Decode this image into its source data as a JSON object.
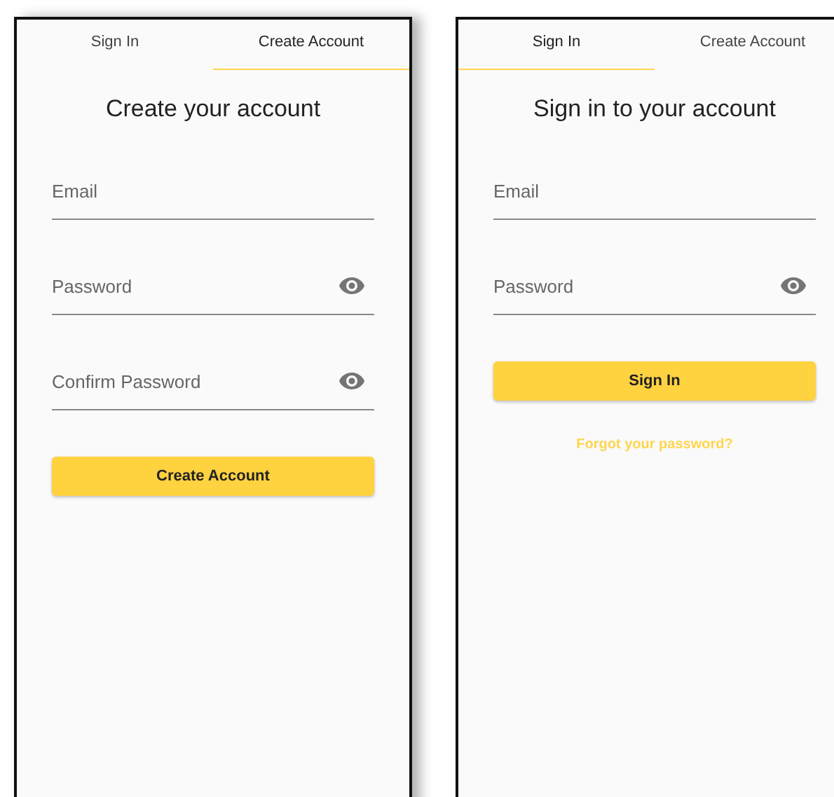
{
  "screens": [
    {
      "tabs": [
        {
          "label": "Sign In",
          "selected": false
        },
        {
          "label": "Create Account",
          "selected": true
        }
      ],
      "heading": "Create your account",
      "fields": [
        {
          "kind": "text",
          "placeholder": "Email"
        },
        {
          "kind": "password",
          "placeholder": "Password"
        },
        {
          "kind": "password",
          "placeholder": "Confirm Password"
        }
      ],
      "button": "Create Account"
    },
    {
      "tabs": [
        {
          "label": "Sign In",
          "selected": true
        },
        {
          "label": "Create Account",
          "selected": false
        }
      ],
      "heading": "Sign in to your account",
      "fields": [
        {
          "kind": "text",
          "placeholder": "Email"
        },
        {
          "kind": "password",
          "placeholder": "Password"
        }
      ],
      "button": "Sign In",
      "link": "Forgot your password?"
    }
  ]
}
